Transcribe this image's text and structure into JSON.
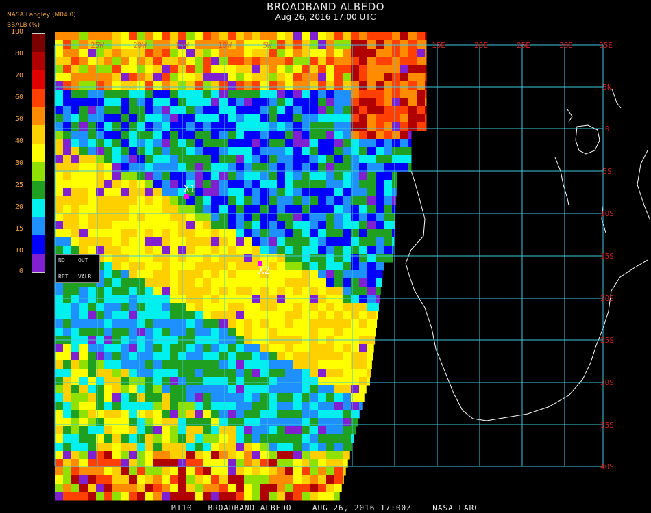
{
  "header": {
    "title": "BROADBAND ALBEDO",
    "subtitle": "Aug 26, 2016 17:00 UTC",
    "source": "NASA Langley (M04.0)"
  },
  "colorbar": {
    "label": "BBALB (%)",
    "ticks": [
      "100",
      "80",
      "70",
      "60",
      "50",
      "40",
      "30",
      "25",
      "20",
      "15",
      "10",
      "0"
    ],
    "colors": [
      "#7a0000",
      "#b00000",
      "#e00000",
      "#ff4000",
      "#ff8c00",
      "#ffd000",
      "#ffff00",
      "#90e000",
      "#20a020",
      "#00f0f0",
      "#1e90ff",
      "#0000ff",
      "#8020d0"
    ]
  },
  "legend": {
    "no": "NO",
    "out": "OUT",
    "ret": "RET",
    "valr": "VALR"
  },
  "map": {
    "lon_labels": [
      "15E",
      "20E",
      "25E",
      "30E",
      "35E"
    ],
    "lat_labels": [
      "5N",
      "0",
      "5S",
      "10S",
      "15S",
      "20S",
      "25S",
      "30S",
      "35S",
      "40S"
    ],
    "top_hidden_lon_labels": [
      "25W",
      "20W",
      "15W",
      "10W",
      "5W"
    ],
    "markers": [
      {
        "label": "X1",
        "color": "#ff00ff"
      },
      {
        "label": "X2",
        "color": "#ff00ff"
      }
    ],
    "grid_color": "#40c8e0",
    "label_color": "#d02020"
  },
  "footer": "MT10   BROADBAND ALBEDO    AUG 26, 2016 17:00Z    NASA LARC"
}
